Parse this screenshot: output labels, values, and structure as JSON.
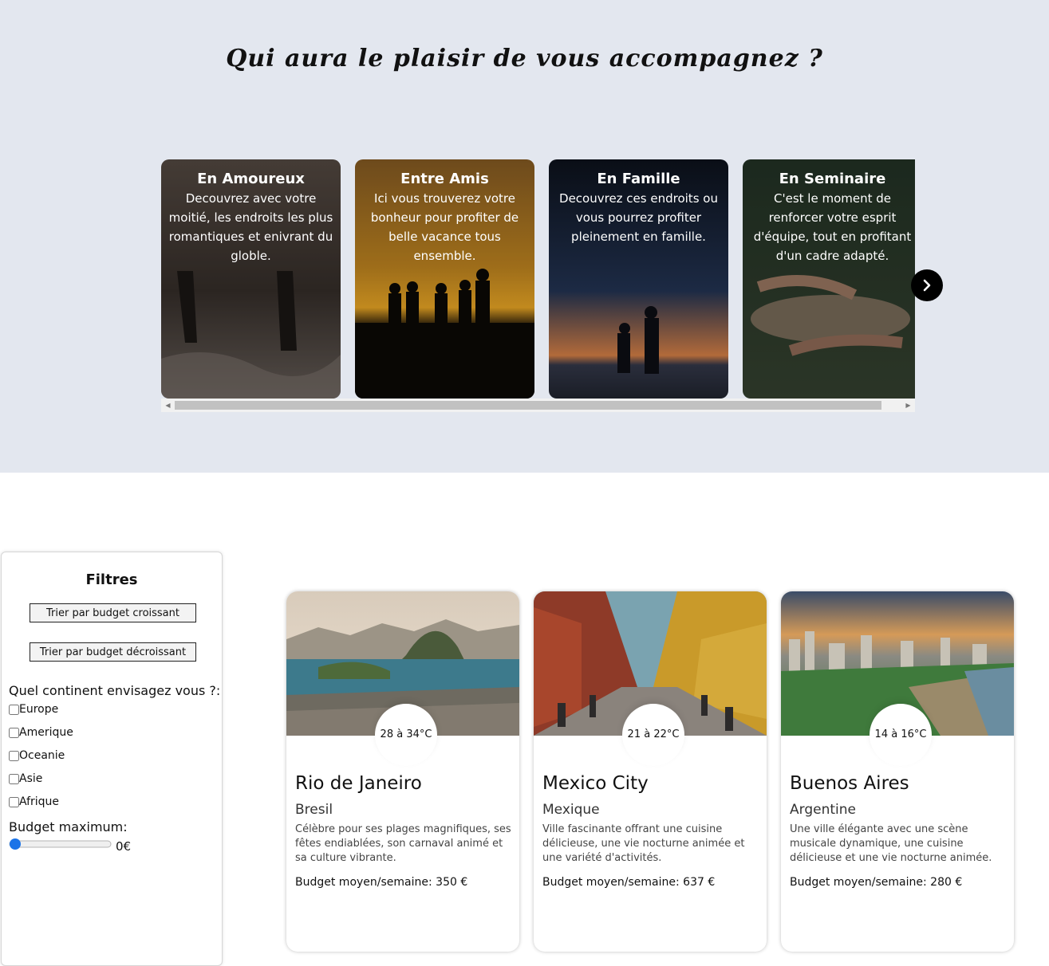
{
  "hero": {
    "title": "Qui aura le plaisir de vous accompagnez ?",
    "categories": [
      {
        "title": "En Amoureux",
        "text": "Decouvrez avec votre moitié, les endroits les plus romantiques et enivrant du globle."
      },
      {
        "title": "Entre Amis",
        "text": "Ici vous trouverez votre bonheur pour profiter de belle vacance tous ensemble."
      },
      {
        "title": "En Famille",
        "text": "Decouvrez ces endroits ou vous pourrez profiter pleinement en famille."
      },
      {
        "title": "En Seminaire",
        "text": "C'est le moment de renforcer votre esprit d'équipe, tout en profitant d'un cadre adapté."
      }
    ],
    "next_icon": "chevron-right-icon"
  },
  "filters": {
    "title": "Filtres",
    "sort_asc": "Trier par budget croissant",
    "sort_desc": "Trier par budget décroissant",
    "continent_question": "Quel continent envisagez vous ?:",
    "continents": [
      "Europe",
      "Amerique",
      "Oceanie",
      "Asie",
      "Afrique"
    ],
    "budget_label": "Budget maximum:",
    "budget_value": "0€",
    "budget_slider_level": 0
  },
  "destinations": [
    {
      "temp": "28 à 34°C",
      "city": "Rio de Janeiro",
      "country": "Bresil",
      "description": "Célèbre pour ses plages magnifiques, ses fêtes endiablées, son carnaval animé et sa culture vibrante.",
      "budget": "Budget moyen/semaine: 350 €"
    },
    {
      "temp": "21 à 22°C",
      "city": "Mexico City",
      "country": "Mexique",
      "description": "Ville fascinante offrant une cuisine délicieuse, une vie nocturne animée et une variété d'activités.",
      "budget": "Budget moyen/semaine: 637 €"
    },
    {
      "temp": "14 à 16°C",
      "city": "Buenos Aires",
      "country": "Argentine",
      "description": "Une ville élégante avec une scène musicale dynamique, une cuisine délicieuse et une vie nocturne animée.",
      "budget": "Budget moyen/semaine: 280 €"
    }
  ]
}
